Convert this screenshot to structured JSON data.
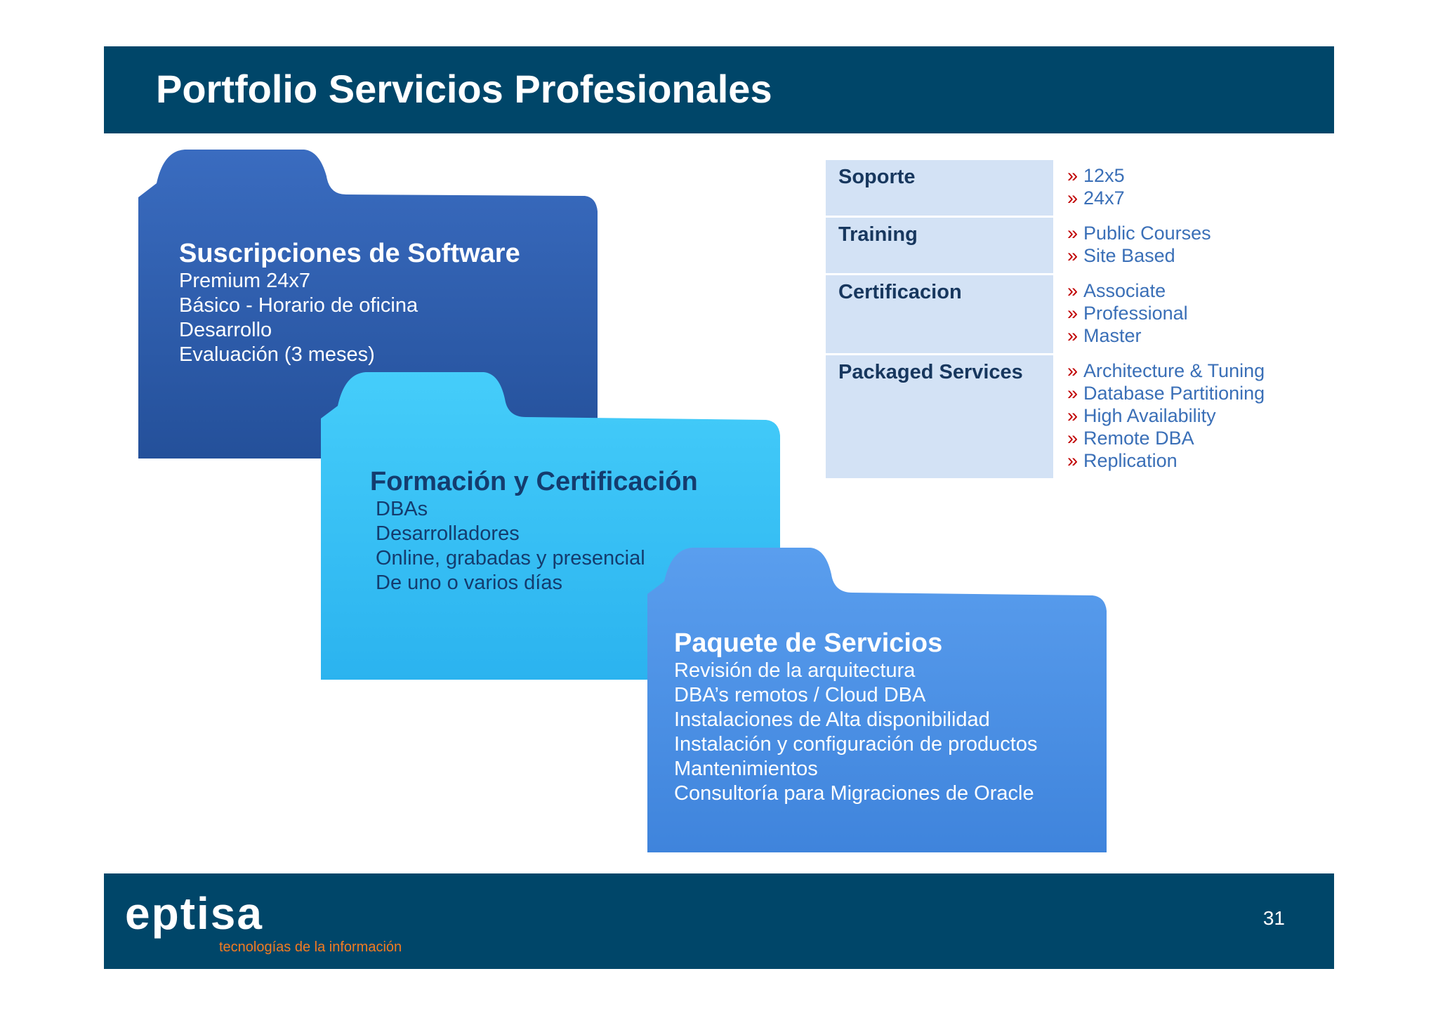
{
  "header": {
    "title": "Portfolio Servicios Profesionales"
  },
  "folders": [
    {
      "title": "Suscripciones de Software",
      "items": [
        "Premium 24x7",
        "Básico - Horario de oficina",
        "Desarrollo",
        "Evaluación (3 meses)"
      ],
      "color": "#2f5da8"
    },
    {
      "title": "Formación y Certificación",
      "items": [
        "DBAs",
        "Desarrolladores",
        "Online, grabadas y presencial",
        "De uno o varios días"
      ],
      "color": "#39c0f5"
    },
    {
      "title": "Paquete de Servicios",
      "items": [
        "Revisión de la arquitectura",
        "DBA’s remotos / Cloud DBA",
        "Instalaciones de Alta disponibilidad",
        "Instalación y configuración de productos",
        "Mantenimientos",
        "Consultoría para Migraciones de Oracle"
      ],
      "color": "#4a8ee0"
    }
  ],
  "services": [
    {
      "category": "Soporte",
      "items": [
        "12x5",
        "24x7"
      ]
    },
    {
      "category": "Training",
      "items": [
        "Public Courses",
        "Site Based"
      ]
    },
    {
      "category": "Certificacion",
      "items": [
        "Associate",
        "Professional",
        "Master"
      ]
    },
    {
      "category": "Packaged Services",
      "items": [
        "Architecture & Tuning",
        "Database Partitioning",
        "High Availability",
        "Remote DBA",
        "Replication"
      ]
    }
  ],
  "bullet": "»",
  "footer": {
    "logo_main": "eptisa",
    "logo_sub": "tecnologías de la información",
    "page_number": "31"
  }
}
